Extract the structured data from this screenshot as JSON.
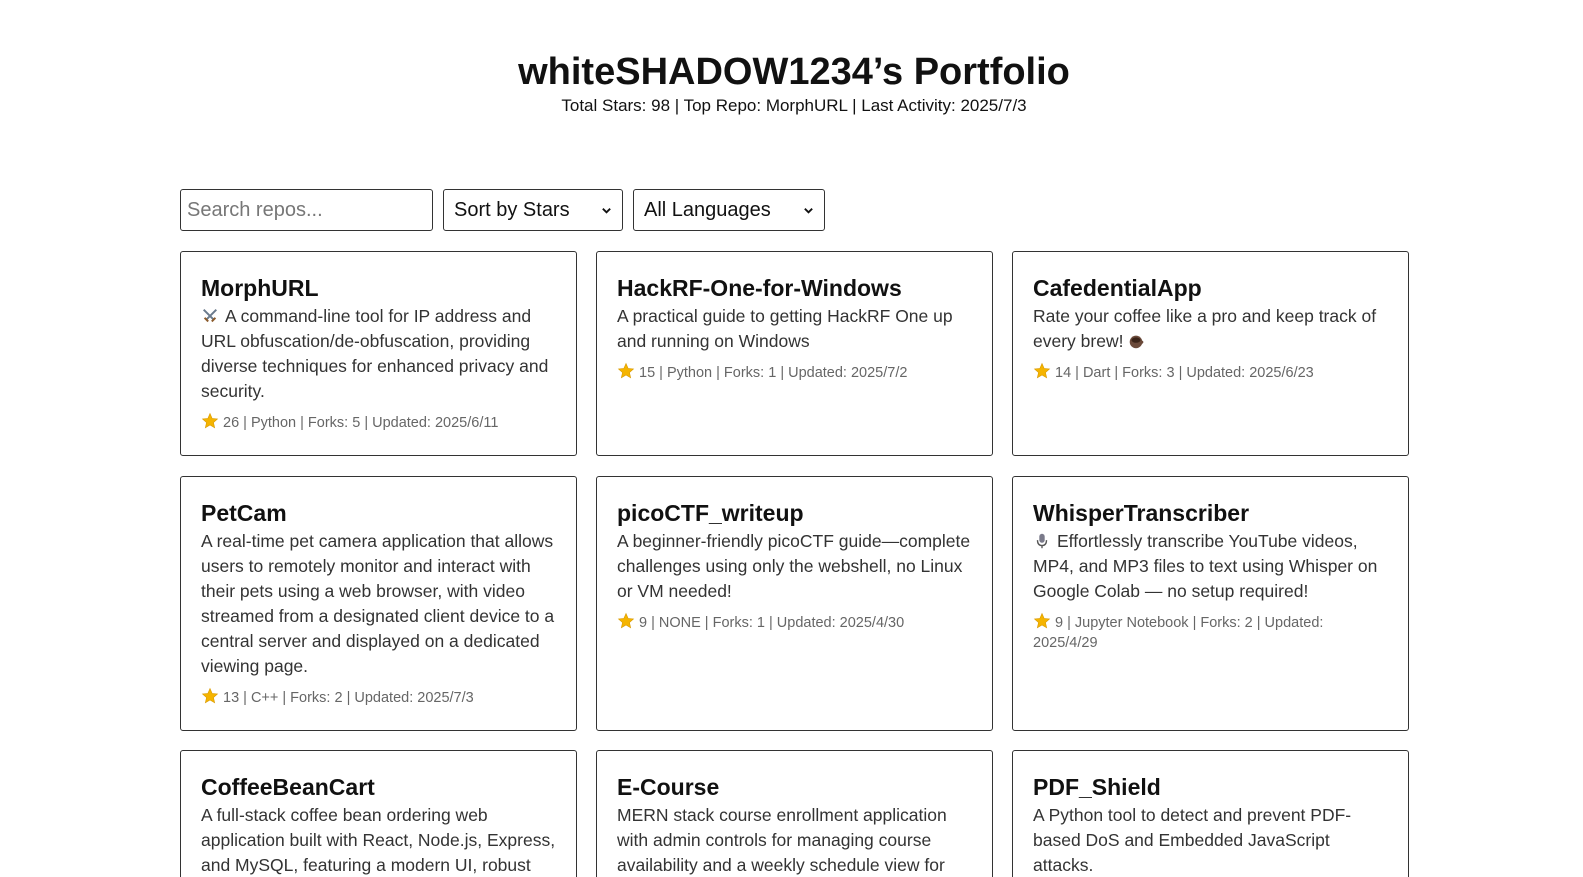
{
  "header": {
    "title": "whiteSHADOW1234’s Portfolio",
    "stats": "Total Stars: 98 | Top Repo: MorphURL | Last Activity: 2025/7/3"
  },
  "controls": {
    "search_placeholder": "Search repos...",
    "sort_selected": "Sort by Stars",
    "language_selected": "All Languages"
  },
  "repos": [
    {
      "name": "MorphURL",
      "icon": "crossed-swords-icon",
      "description": "A command-line tool for IP address and URL obfuscation/de-obfuscation, providing diverse techniques for enhanced privacy and security.",
      "meta": "26 | Python | Forks: 5 | Updated: 2025/6/11"
    },
    {
      "name": "HackRF-One-for-Windows",
      "description": "A practical guide to getting HackRF One up and running on Windows",
      "meta": "15 | Python | Forks: 1 | Updated: 2025/7/2"
    },
    {
      "name": "CafedentialApp",
      "icon": "coffee-icon",
      "description": "Rate your coffee like a pro and keep track of every brew!",
      "meta": "14 | Dart | Forks: 3 | Updated: 2025/6/23"
    },
    {
      "name": "PetCam",
      "description": "A real-time pet camera application that allows users to remotely monitor and interact with their pets using a web browser, with video streamed from a designated client device to a central server and displayed on a dedicated viewing page.",
      "meta": "13 | C++ | Forks: 2 | Updated: 2025/7/3"
    },
    {
      "name": "picoCTF_writeup",
      "description": "A beginner-friendly picoCTF guide—complete challenges using only the webshell, no Linux or VM needed!",
      "meta": "9 | NONE | Forks: 1 | Updated: 2025/4/30"
    },
    {
      "name": "WhisperTranscriber",
      "icon": "microphone-icon",
      "description": "Effortlessly transcribe YouTube videos, MP4, and MP3 files to text using Whisper on Google Colab — no setup required!",
      "meta": "9 | Jupyter Notebook | Forks: 2 | Updated: 2025/4/29"
    },
    {
      "name": "CoffeeBeanCart",
      "description": "A full-stack coffee bean ordering web application built with React, Node.js, Express, and MySQL, featuring a modern UI, robust"
    },
    {
      "name": "E-Course",
      "description": "MERN stack course enrollment application with admin controls for managing course availability and a weekly schedule view for"
    },
    {
      "name": "PDF_Shield",
      "description": "A Python tool to detect and prevent PDF-based DoS and Embedded JavaScript attacks."
    }
  ],
  "colors": {
    "star": "#f5b400",
    "border": "#333333",
    "meta_text": "#666666",
    "desc_text": "#333333"
  }
}
